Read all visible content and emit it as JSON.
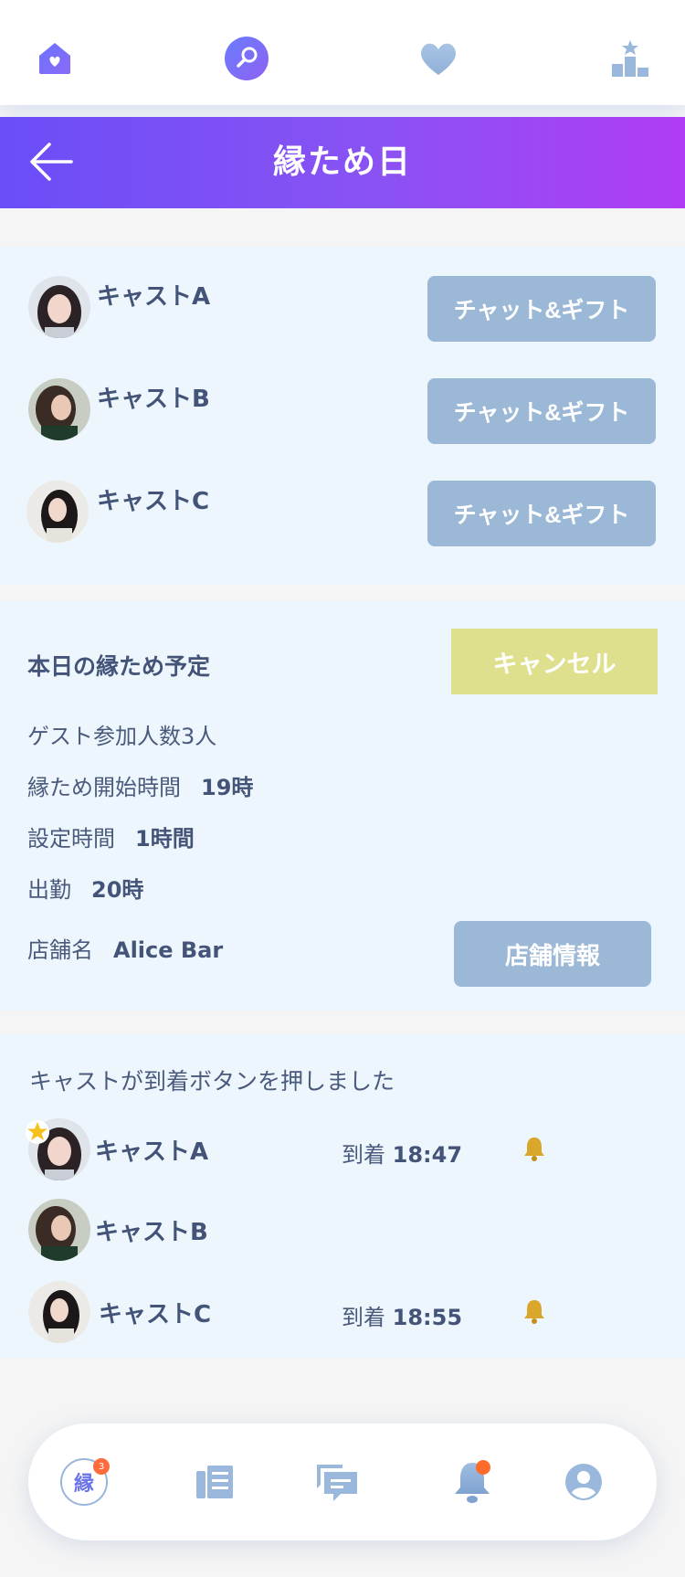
{
  "top_nav": {
    "icons": [
      "home-heart-icon",
      "search-icon",
      "heart-icon",
      "ranking-icon"
    ]
  },
  "header": {
    "title": "縁ため日",
    "back_icon": "back-arrow-icon"
  },
  "casts": [
    {
      "name": "キャストA",
      "button": "チャット&ギフト"
    },
    {
      "name": "キャストB",
      "button": "チャット&ギフト"
    },
    {
      "name": "キャストC",
      "button": "チャット&ギフト"
    }
  ],
  "schedule": {
    "title": "本日の縁ため予定",
    "cancel_label": "キャンセル",
    "guests_label": "ゲスト参加人数3人",
    "start_label": "縁ため開始時間",
    "start_value": "19時",
    "duration_label": "設定時間",
    "duration_value": "1時間",
    "shift_label": "出勤",
    "shift_value": "20時",
    "store_label": "店舗名",
    "store_value": "Alice Bar",
    "store_button": "店舗情報"
  },
  "arrivals": {
    "title": "キャストが到着ボタンを押しました",
    "items": [
      {
        "name": "キャストA",
        "label": "到着",
        "time": "18:47",
        "starred": true
      },
      {
        "name": "キャストB",
        "label": "",
        "time": "",
        "starred": false
      },
      {
        "name": "キャストC",
        "label": "到着",
        "time": "18:55",
        "starred": false
      }
    ]
  },
  "bottom_nav": {
    "en_label": "縁",
    "en_count": "3",
    "icons": [
      "en-icon",
      "list-icon",
      "chat-icon",
      "bell-icon",
      "profile-icon"
    ]
  },
  "colors": {
    "header_gradient_start": "#6b4ef8",
    "header_gradient_end": "#b03cf4",
    "button_blue": "#9cb8d7",
    "button_cancel": "#dfe08e",
    "panel_bg": "#eef6fd",
    "accent_orange": "#ff6b2a"
  }
}
